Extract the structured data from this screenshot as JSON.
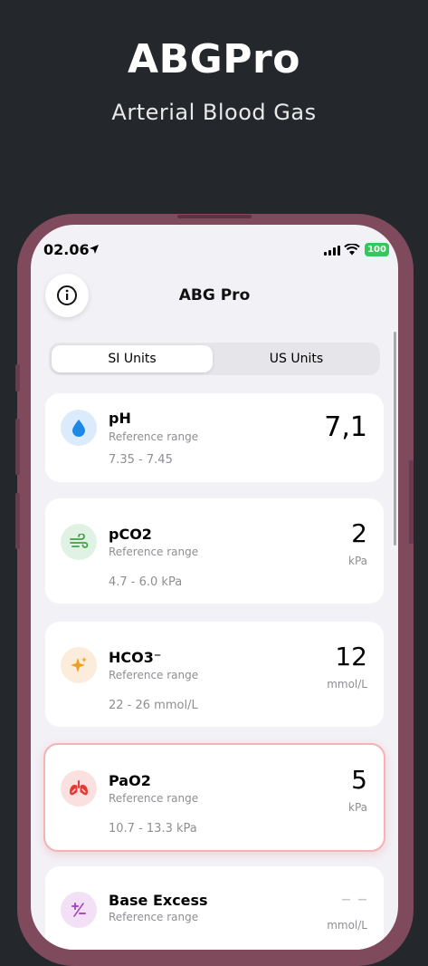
{
  "promo": {
    "title": "ABGPro",
    "subtitle": "Arterial Blood Gas"
  },
  "status_bar": {
    "time": "02.06",
    "battery": "100"
  },
  "nav": {
    "title": "ABG Pro",
    "info_icon": "info-circle-icon"
  },
  "units_toggle": {
    "options": [
      "SI Units",
      "US Units"
    ],
    "selected": "SI Units"
  },
  "parameters": [
    {
      "name": "pH",
      "ref_label": "Reference range",
      "range": "7.35 - 7.45",
      "value": "7,1",
      "unit": "",
      "icon": "droplet-icon",
      "icon_color": "#1e88e5"
    },
    {
      "name": "pCO2",
      "ref_label": "Reference range",
      "range": "4.7 - 6.0 kPa",
      "value": "2",
      "unit": "kPa",
      "icon": "wind-icon",
      "icon_color": "#43a047"
    },
    {
      "name": "HCO3⁻",
      "ref_label": "Reference range",
      "range": "22 - 26 mmol/L",
      "value": "12",
      "unit": "mmol/L",
      "icon": "sparkles-icon",
      "icon_color": "#f0a020"
    },
    {
      "name": "PaO2",
      "ref_label": "Reference range",
      "range": "10.7 - 13.3 kPa",
      "value": "5",
      "unit": "kPa",
      "icon": "lungs-icon",
      "icon_color": "#e53935"
    },
    {
      "name": "Base Excess",
      "ref_label": "Reference range",
      "range": "",
      "value": "– –",
      "unit": "mmol/L",
      "icon": "plus-minus-icon",
      "icon_color": "#a54bc4"
    }
  ]
}
